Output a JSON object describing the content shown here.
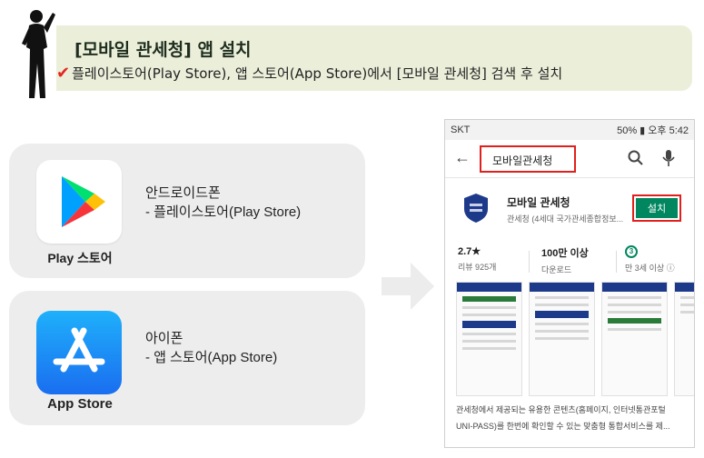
{
  "header": {
    "title": "[모바일 관세청] 앱 설치",
    "subtitle": "플레이스토어(Play Store), 앱 스토어(App Store)에서 [모바일 관세청] 검색 후 설치",
    "check_glyph": "✔"
  },
  "android_card": {
    "store_name": "Play 스토어",
    "platform": "안드로이드폰",
    "instruction": "- 플레이스토어(Play Store)"
  },
  "ios_card": {
    "store_name": "App Store",
    "platform": "아이폰",
    "instruction": "- 앱 스토어(App Store)"
  },
  "phone": {
    "status_left": "SKT",
    "status_right": "50% ▮ 오후 5:42",
    "search_query": "모바일관세청",
    "app": {
      "name": "모바일 관세청",
      "developer": "관세청 (4세대 국가관세종합정보...",
      "install_label": "설치"
    },
    "stats": [
      {
        "main": "2.7★",
        "sub": "리뷰 925개"
      },
      {
        "main": "100만 이상",
        "sub": "다운로드"
      },
      {
        "main": "3",
        "sub": "만 3세 이상 ⓘ"
      }
    ],
    "description_line1": "관세청에서 제공되는 유용한 콘텐츠(홈페이지, 인터넷통관포털",
    "description_line2": "UNI-PASS)를 한번에 확인할 수 있는 맞춤형 통합서비스를 제..."
  },
  "colors": {
    "banner_bg": "#ebefda",
    "card_bg": "#ededed",
    "install_green": "#01875f",
    "highlight_red": "#e0201d",
    "check_red": "#e3261d",
    "app_store_blue": "#1a6ef0"
  },
  "icons": [
    "person-silhouette-icon",
    "check-icon",
    "play-store-icon",
    "app-store-icon",
    "arrow-right-icon",
    "back-arrow-icon",
    "search-icon",
    "mic-icon",
    "customs-logo-icon"
  ]
}
